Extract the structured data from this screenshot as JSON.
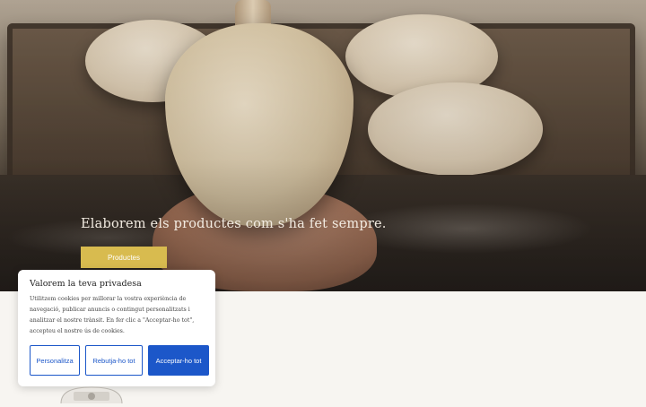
{
  "hero": {
    "tagline": "Elaborem els productes com s'ha fet sempre.",
    "cta_label": "Productes",
    "cta_color": "#d8bb4f"
  },
  "cookie_banner": {
    "title": "Valorem la teva privadesa",
    "body": "Utilitzem cookies per millorar la vostra experiència de navegació, publicar anuncis o contingut personalitzats i analitzar el nostre trànsit. En fer clic a \"Acceptar-ho tot\", accepteu el nostre ús de cookies.",
    "buttons": {
      "customize": "Personalitza",
      "reject": "Rebutja-ho tot",
      "accept": "Acceptar-ho tot"
    },
    "accent_color": "#1c57c9"
  },
  "logo": {
    "icon": "bakery-logo-icon"
  }
}
